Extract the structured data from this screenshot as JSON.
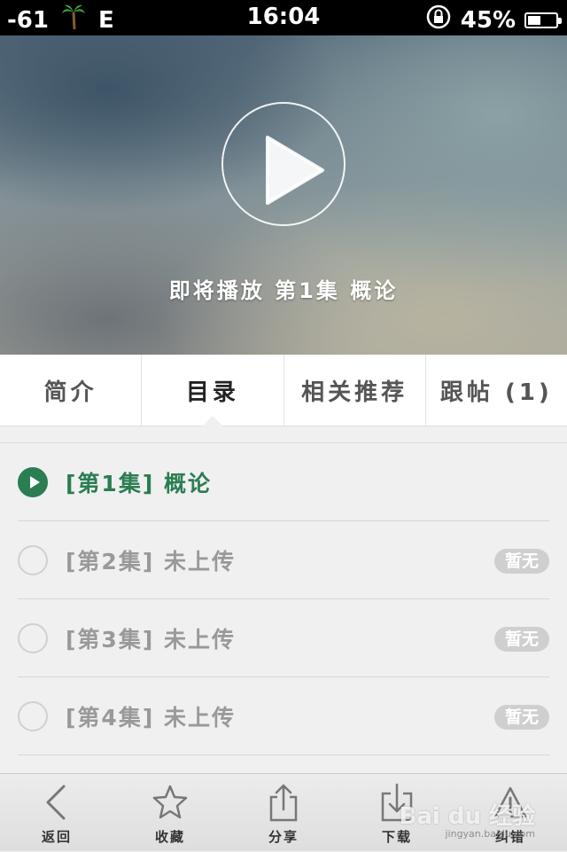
{
  "status_bar": {
    "signal": "-61",
    "network": "E",
    "time": "16:04",
    "battery": "45%",
    "battery_level": 0.45
  },
  "video": {
    "caption": "即将播放 第1集 概论",
    "play_icon": "play-icon"
  },
  "tabs": [
    {
      "label": "简介",
      "active": false
    },
    {
      "label": "目录",
      "active": true
    },
    {
      "label": "相关推荐",
      "active": false
    },
    {
      "label": "跟帖 (1)",
      "active": false
    }
  ],
  "episodes": [
    {
      "label": "[第1集] 概论",
      "active": true,
      "badge": ""
    },
    {
      "label": "[第2集] 未上传",
      "active": false,
      "badge": "暂无"
    },
    {
      "label": "[第3集] 未上传",
      "active": false,
      "badge": "暂无"
    },
    {
      "label": "[第4集] 未上传",
      "active": false,
      "badge": "暂无"
    }
  ],
  "toolbar": {
    "back": "返回",
    "favorite": "收藏",
    "share": "分享",
    "download": "下载",
    "report": "纠错"
  },
  "watermark": {
    "text": "Bai du 经验",
    "sub": "jingyan.baidu.com"
  },
  "colors": {
    "accent": "#2b7d52"
  }
}
